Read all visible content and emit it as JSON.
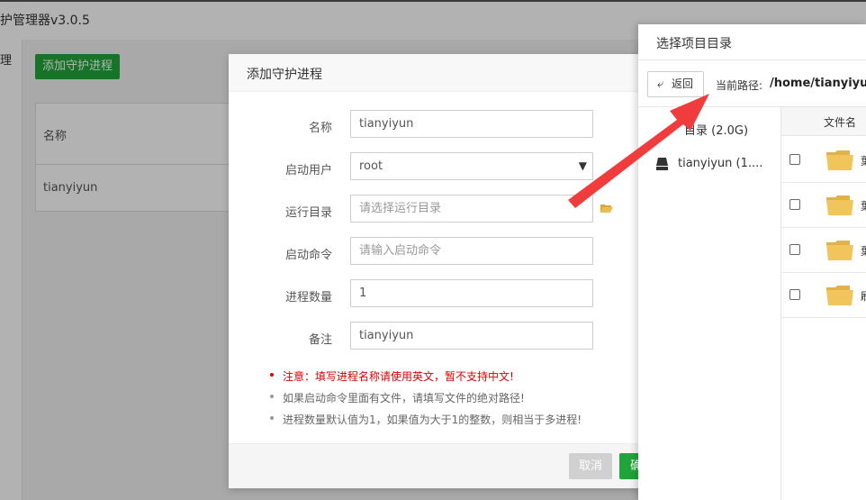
{
  "app": {
    "title": "护管理器v3.0.5",
    "left_strip_text": "理"
  },
  "main": {
    "add_button": "添加守护进程",
    "table_header_name": "名称",
    "rows": [
      {
        "name": "tianyiyun"
      }
    ]
  },
  "dialog": {
    "title": "添加守护进程",
    "fields": {
      "name": {
        "label": "名称",
        "value": "tianyiyun"
      },
      "user": {
        "label": "启动用户",
        "value": "root"
      },
      "run_dir": {
        "label": "运行目录",
        "placeholder": "请选择运行目录"
      },
      "command": {
        "label": "启动命令",
        "placeholder": "请输入启动命令"
      },
      "count": {
        "label": "进程数量",
        "value": "1"
      },
      "remark": {
        "label": "备注",
        "value": "tianyiyun"
      }
    },
    "tips": [
      "注意：填写进程名称请使用英文，暂不支持中文!",
      "如果启动命令里面有文件，请填写文件的绝对路径!",
      "进程数量默认值为1，如果值为大于1的整数，则相当于多进程!"
    ],
    "cancel": "取消",
    "confirm": "确"
  },
  "panel": {
    "title": "选择项目目录",
    "back": "返回",
    "path_label": "当前路径:",
    "path_value": "/home/tianyiyun",
    "tree_root": "目录 (2.0G)",
    "tree_item": "tianyiyun (1....",
    "file_header": "文件名",
    "row_initials": [
      "葉",
      "葉",
      "葉",
      "刷"
    ]
  },
  "colors": {
    "accent_green": "#20a53a",
    "warning_red": "#dd0000",
    "arrow_red": "#f03c3c",
    "folder_yellow": "#f2c55c"
  }
}
